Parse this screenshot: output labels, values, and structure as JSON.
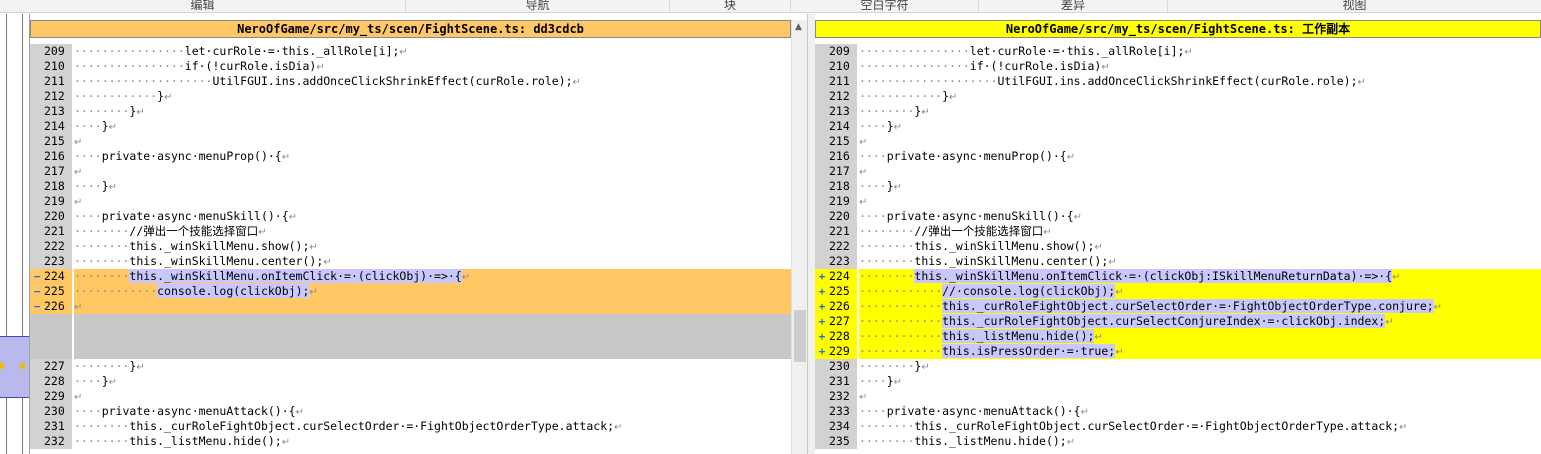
{
  "ribbon": {
    "tabs": [
      "编辑",
      "导航",
      "块",
      "空白字符",
      "差异",
      "视图"
    ]
  },
  "left": {
    "title": "NeroOfGame/src/my_ts/scen/FightScene.ts: dd3cdcb",
    "color": "#ffc864",
    "lines": [
      {
        "n": "209",
        "indent": 16,
        "code": "let·curRole·=·this._allRole[i];",
        "type": "same"
      },
      {
        "n": "210",
        "indent": 16,
        "code": "if·(!curRole.isDia)",
        "type": "same"
      },
      {
        "n": "211",
        "indent": 20,
        "code": "UtilFGUI.ins.addOnceClickShrinkEffect(curRole.role);",
        "type": "same"
      },
      {
        "n": "212",
        "indent": 12,
        "code": "}",
        "type": "same"
      },
      {
        "n": "213",
        "indent": 8,
        "code": "}",
        "type": "same"
      },
      {
        "n": "214",
        "indent": 4,
        "code": "}",
        "type": "same"
      },
      {
        "n": "215",
        "indent": 0,
        "code": "",
        "type": "same"
      },
      {
        "n": "216",
        "indent": 4,
        "code": "private·async·menuProp()·{",
        "type": "same"
      },
      {
        "n": "217",
        "indent": 0,
        "code": "",
        "type": "same"
      },
      {
        "n": "218",
        "indent": 4,
        "code": "}",
        "type": "same"
      },
      {
        "n": "219",
        "indent": 0,
        "code": "",
        "type": "same"
      },
      {
        "n": "220",
        "indent": 4,
        "code": "private·async·menuSkill()·{",
        "type": "same"
      },
      {
        "n": "221",
        "indent": 8,
        "code": "//弹出一个技能选择窗口",
        "type": "same"
      },
      {
        "n": "222",
        "indent": 8,
        "code": "this._winSkillMenu.show();",
        "type": "same"
      },
      {
        "n": "223",
        "indent": 8,
        "code": "this._winSkillMenu.center();",
        "type": "same"
      },
      {
        "n": "224",
        "indent": 8,
        "code": "this._winSkillMenu.onItemClick·=·(clickObj)·=>·{",
        "type": "removed",
        "mark": "−"
      },
      {
        "n": "225",
        "indent": 12,
        "code": "console.log(clickObj);",
        "type": "removed",
        "mark": "−"
      },
      {
        "n": "226",
        "indent": 0,
        "code": "",
        "type": "removed",
        "mark": "−"
      },
      {
        "n": "",
        "indent": 0,
        "code": "",
        "type": "ph"
      },
      {
        "n": "",
        "indent": 0,
        "code": "",
        "type": "ph"
      },
      {
        "n": "",
        "indent": 0,
        "code": "",
        "type": "ph"
      },
      {
        "n": "227",
        "indent": 8,
        "code": "}",
        "type": "same"
      },
      {
        "n": "228",
        "indent": 4,
        "code": "}",
        "type": "same"
      },
      {
        "n": "229",
        "indent": 0,
        "code": "",
        "type": "same"
      },
      {
        "n": "230",
        "indent": 4,
        "code": "private·async·menuAttack()·{",
        "type": "same"
      },
      {
        "n": "231",
        "indent": 8,
        "code": "this._curRoleFightObject.curSelectOrder·=·FightObjectOrderType.attack;",
        "type": "same"
      },
      {
        "n": "232",
        "indent": 8,
        "code": "this._listMenu.hide();",
        "type": "same"
      }
    ]
  },
  "right": {
    "title": "NeroOfGame/src/my_ts/scen/FightScene.ts: 工作副本",
    "color": "#ffff00",
    "lines": [
      {
        "n": "209",
        "indent": 16,
        "code": "let·curRole·=·this._allRole[i];",
        "type": "same"
      },
      {
        "n": "210",
        "indent": 16,
        "code": "if·(!curRole.isDia)",
        "type": "same"
      },
      {
        "n": "211",
        "indent": 20,
        "code": "UtilFGUI.ins.addOnceClickShrinkEffect(curRole.role);",
        "type": "same"
      },
      {
        "n": "212",
        "indent": 12,
        "code": "}",
        "type": "same"
      },
      {
        "n": "213",
        "indent": 8,
        "code": "}",
        "type": "same"
      },
      {
        "n": "214",
        "indent": 4,
        "code": "}",
        "type": "same"
      },
      {
        "n": "215",
        "indent": 0,
        "code": "",
        "type": "same"
      },
      {
        "n": "216",
        "indent": 4,
        "code": "private·async·menuProp()·{",
        "type": "same"
      },
      {
        "n": "217",
        "indent": 0,
        "code": "",
        "type": "same"
      },
      {
        "n": "218",
        "indent": 4,
        "code": "}",
        "type": "same"
      },
      {
        "n": "219",
        "indent": 0,
        "code": "",
        "type": "same"
      },
      {
        "n": "220",
        "indent": 4,
        "code": "private·async·menuSkill()·{",
        "type": "same"
      },
      {
        "n": "221",
        "indent": 8,
        "code": "//弹出一个技能选择窗口",
        "type": "same"
      },
      {
        "n": "222",
        "indent": 8,
        "code": "this._winSkillMenu.show();",
        "type": "same"
      },
      {
        "n": "223",
        "indent": 8,
        "code": "this._winSkillMenu.center();",
        "type": "same"
      },
      {
        "n": "224",
        "indent": 8,
        "code": "this._winSkillMenu.onItemClick·=·(clickObj:ISkillMenuReturnData)·=>·{",
        "type": "added",
        "mark": "+"
      },
      {
        "n": "225",
        "indent": 12,
        "code": "//·console.log(clickObj);",
        "type": "added",
        "mark": "+"
      },
      {
        "n": "226",
        "indent": 12,
        "code": "this._curRoleFightObject.curSelectOrder·=·FightObjectOrderType.conjure;",
        "type": "added",
        "mark": "+"
      },
      {
        "n": "227",
        "indent": 12,
        "code": "this._curRoleFightObject.curSelectConjureIndex·=·clickObj.index;",
        "type": "added",
        "mark": "+"
      },
      {
        "n": "228",
        "indent": 12,
        "code": "this._listMenu.hide();",
        "type": "added",
        "mark": "+"
      },
      {
        "n": "229",
        "indent": 12,
        "code": "this.isPressOrder·=·true;",
        "type": "added",
        "mark": "+"
      },
      {
        "n": "230",
        "indent": 8,
        "code": "}",
        "type": "same"
      },
      {
        "n": "231",
        "indent": 4,
        "code": "}",
        "type": "same"
      },
      {
        "n": "232",
        "indent": 0,
        "code": "",
        "type": "same"
      },
      {
        "n": "233",
        "indent": 4,
        "code": "private·async·menuAttack()·{",
        "type": "same"
      },
      {
        "n": "234",
        "indent": 8,
        "code": "this._curRoleFightObject.curSelectOrder·=·FightObjectOrderType.attack;",
        "type": "same"
      },
      {
        "n": "235",
        "indent": 8,
        "code": "this._listMenu.hide();",
        "type": "same"
      }
    ]
  },
  "colors": {
    "removed": "#ffc864",
    "added": "#ffff00",
    "highlight": "#c8c8ff",
    "gutter": "#d2d2d2",
    "placeholder": "#c8c8c8"
  }
}
